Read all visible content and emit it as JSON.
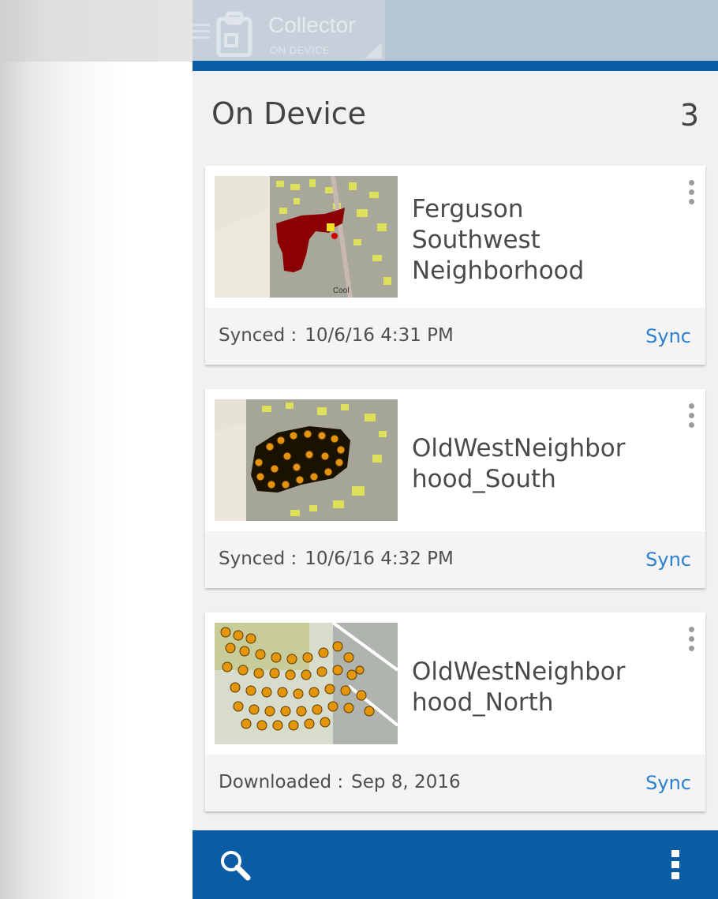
{
  "app": {
    "title": "Collector",
    "subtitle": "ON DEVICE"
  },
  "section": {
    "title": "On Device",
    "count": "3"
  },
  "colors": {
    "brand_blue": "#0a5da4",
    "link_blue": "#2b7fd0",
    "card_bg": "#ffffff",
    "footer_bg": "#f4f4f4",
    "area_red": "#8b0000",
    "point_orange": "#e8960c"
  },
  "maps": [
    {
      "title_lines": [
        "Ferguson",
        "Southwest",
        "Neighborhood"
      ],
      "status_label": "Synced :",
      "status_value": "10/6/16 4:31 PM",
      "action_label": "Sync",
      "thumb_label": "Cool",
      "thumb_icon": "map-thumbnail-red-polygon"
    },
    {
      "title_lines": [
        "OldWestNeighbor",
        "hood_South"
      ],
      "status_label": "Synced :",
      "status_value": "10/6/16 4:32 PM",
      "action_label": "Sync",
      "thumb_label": "",
      "thumb_icon": "map-thumbnail-orange-points"
    },
    {
      "title_lines": [
        "OldWestNeighbor",
        "hood_North"
      ],
      "status_label": "Downloaded :",
      "status_value": "Sep 8, 2016",
      "action_label": "Sync",
      "thumb_label": "",
      "thumb_icon": "map-thumbnail-orange-points"
    }
  ],
  "icons": {
    "menu": "hamburger-menu-icon",
    "app": "clipboard-icon",
    "card_menu": "vertical-dots-icon",
    "search": "search-icon",
    "overflow": "overflow-menu-icon"
  }
}
